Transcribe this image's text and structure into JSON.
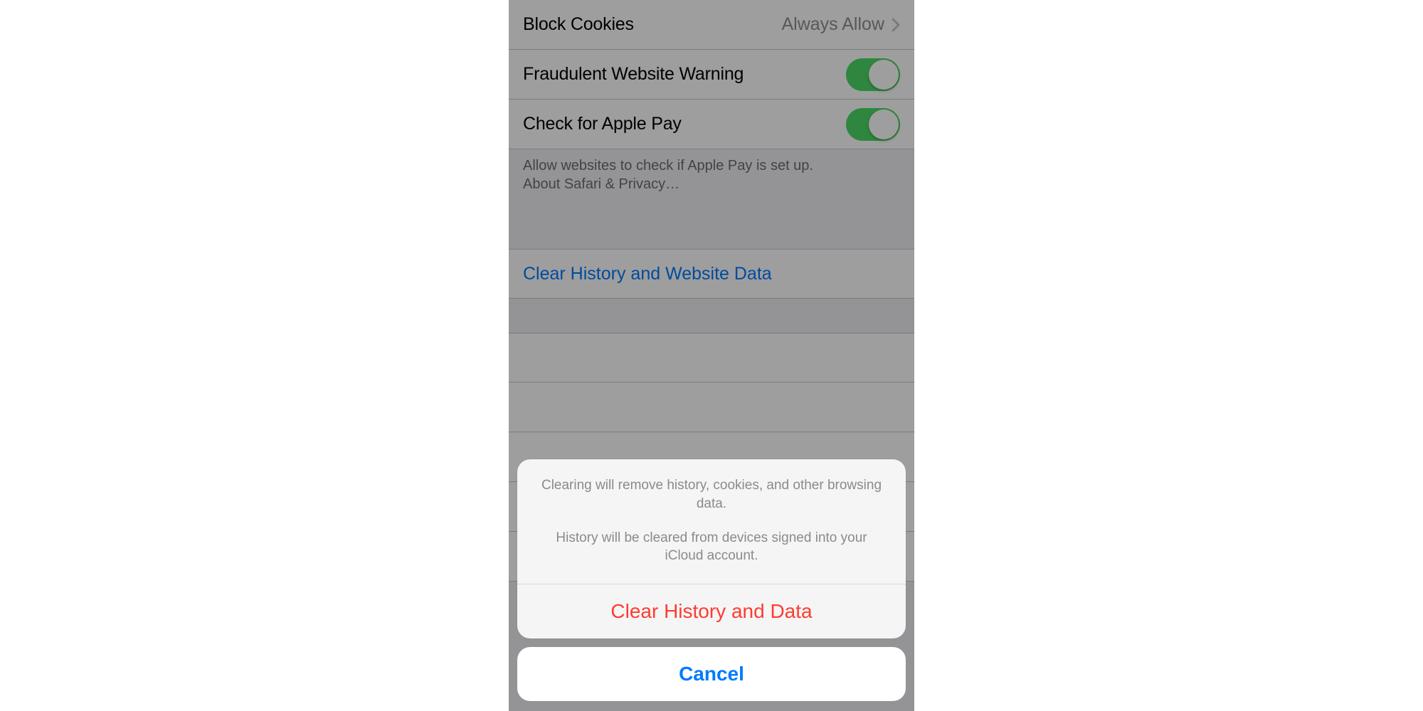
{
  "settings": {
    "block_cookies": {
      "label": "Block Cookies",
      "value": "Always Allow"
    },
    "fraud_warning": {
      "label": "Fraudulent Website Warning",
      "on": true
    },
    "apple_pay": {
      "label": "Check for Apple Pay",
      "on": true
    },
    "footer": {
      "line1": "Allow websites to check if Apple Pay is set up.",
      "line2": "About Safari & Privacy…"
    },
    "clear_history_link": "Clear History and Website Data"
  },
  "action_sheet": {
    "message_line1": "Clearing will remove history, cookies, and other browsing data.",
    "message_line2": "History will be cleared from devices signed into your iCloud account.",
    "destructive_label": "Clear History and Data",
    "cancel_label": "Cancel"
  },
  "colors": {
    "ios_blue": "#007aff",
    "ios_red": "#ff3b30",
    "ios_green": "#4cd964"
  }
}
